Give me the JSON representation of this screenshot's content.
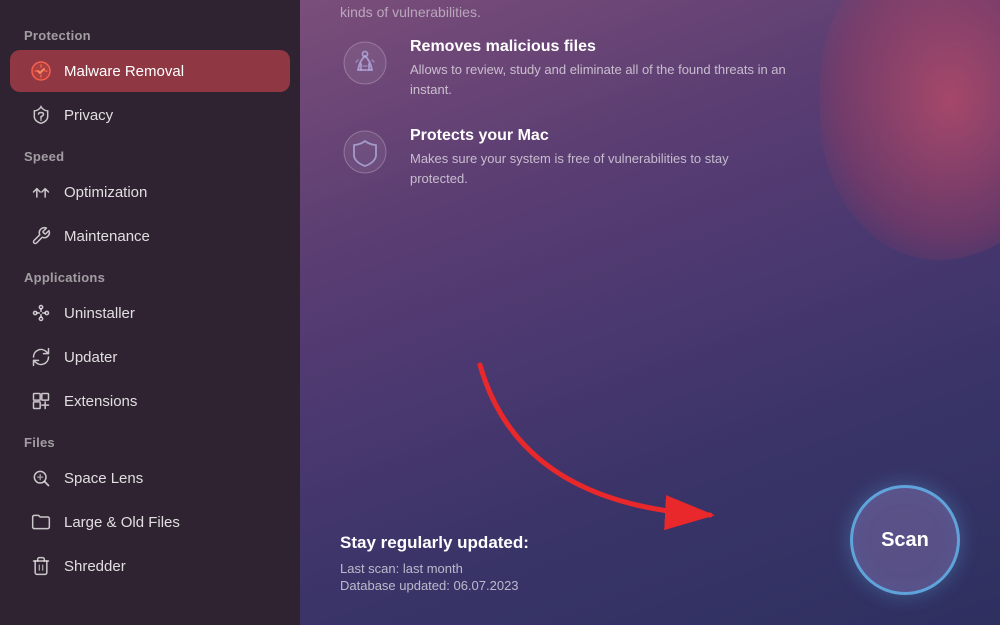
{
  "sidebar": {
    "sections": [
      {
        "label": "Protection",
        "items": [
          {
            "id": "malware-removal",
            "label": "Malware Removal",
            "icon": "🛡️",
            "active": true
          },
          {
            "id": "privacy",
            "label": "Privacy",
            "icon": "✋",
            "active": false
          }
        ]
      },
      {
        "label": "Speed",
        "items": [
          {
            "id": "optimization",
            "label": "Optimization",
            "icon": "⚙️",
            "active": false
          },
          {
            "id": "maintenance",
            "label": "Maintenance",
            "icon": "🔧",
            "active": false
          }
        ]
      },
      {
        "label": "Applications",
        "items": [
          {
            "id": "uninstaller",
            "label": "Uninstaller",
            "icon": "🔗",
            "active": false
          },
          {
            "id": "updater",
            "label": "Updater",
            "icon": "🔄",
            "active": false
          },
          {
            "id": "extensions",
            "label": "Extensions",
            "icon": "🔀",
            "active": false
          }
        ]
      },
      {
        "label": "Files",
        "items": [
          {
            "id": "space-lens",
            "label": "Space Lens",
            "icon": "◎",
            "active": false
          },
          {
            "id": "large-old-files",
            "label": "Large & Old Files",
            "icon": "🗂️",
            "active": false
          },
          {
            "id": "shredder",
            "label": "Shredder",
            "icon": "🗑️",
            "active": false
          }
        ]
      }
    ]
  },
  "main": {
    "top_text": "kinds of vulnerabilities.",
    "features": [
      {
        "id": "removes-malicious",
        "title": "Removes malicious files",
        "description": "Allows to review, study and eliminate all of the found threats in an instant."
      },
      {
        "id": "protects-mac",
        "title": "Protects your Mac",
        "description": "Makes sure your system is free of vulnerabilities to stay protected."
      }
    ],
    "update_section": {
      "heading": "Stay regularly updated:",
      "last_scan": "Last scan: last month",
      "database_updated": "Database updated: 06.07.2023"
    },
    "scan_button_label": "Scan"
  }
}
